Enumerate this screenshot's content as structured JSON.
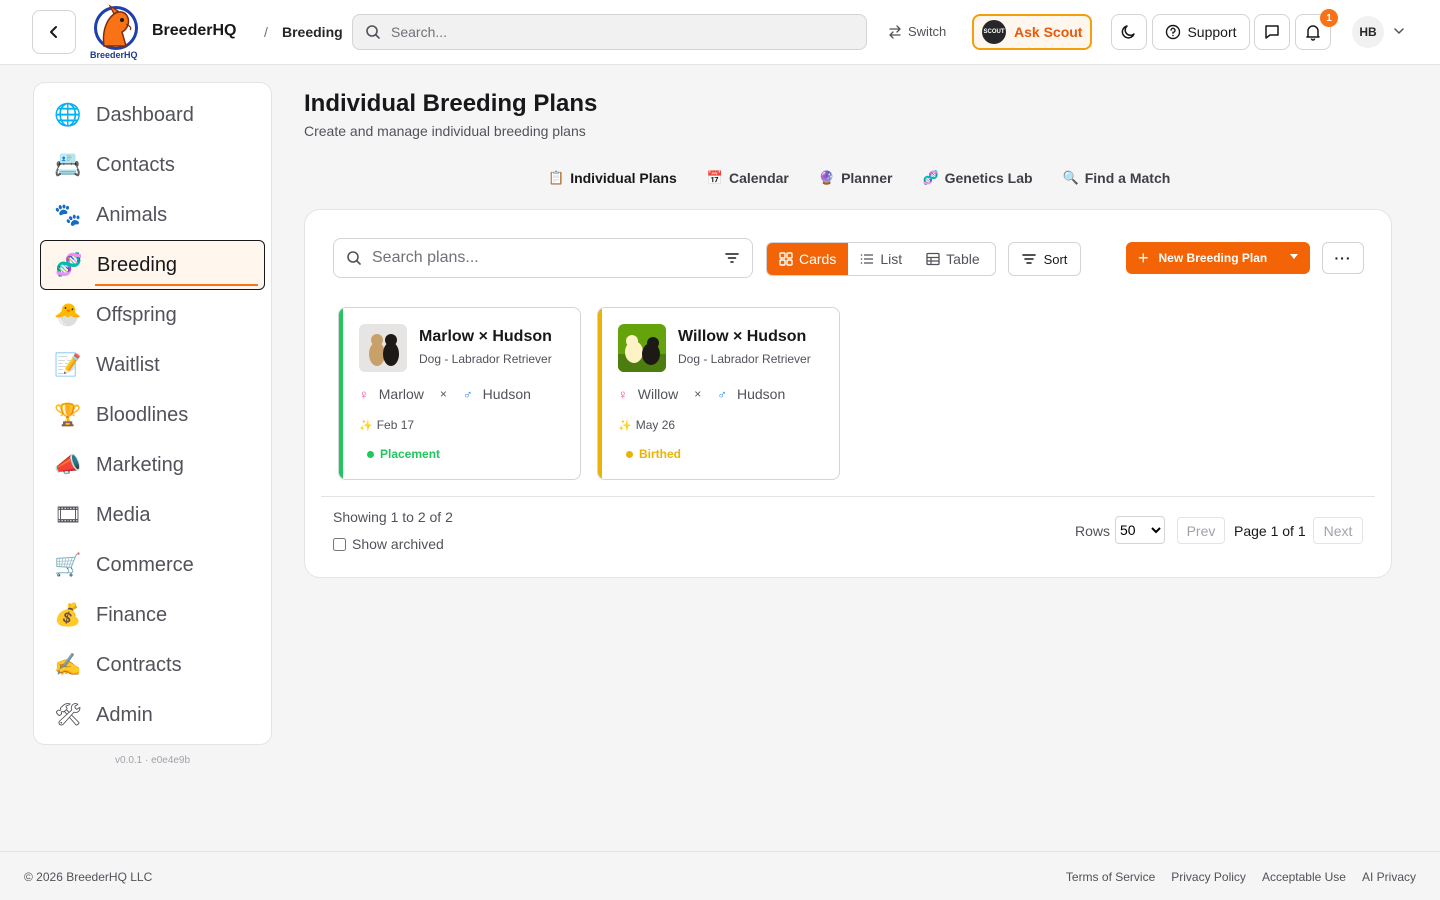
{
  "header": {
    "brand": "BreederHQ",
    "logo_label": "BreederHQ",
    "breadcrumb_sep": "/",
    "breadcrumb": "Breeding",
    "search_placeholder": "Search...",
    "switch_label": "Switch",
    "ask_scout_label": "Ask Scout",
    "scout_badge": "SCOUT",
    "support_label": "Support",
    "notification_count": "1",
    "avatar_initials": "HB"
  },
  "sidebar": {
    "items": [
      {
        "label": "Dashboard",
        "icon": "🌐"
      },
      {
        "label": "Contacts",
        "icon": "📇"
      },
      {
        "label": "Animals",
        "icon": "🐾"
      },
      {
        "label": "Breeding",
        "icon": "🧬"
      },
      {
        "label": "Offspring",
        "icon": "🐣"
      },
      {
        "label": "Waitlist",
        "icon": "📝"
      },
      {
        "label": "Bloodlines",
        "icon": "🏆"
      },
      {
        "label": "Marketing",
        "icon": "📣"
      },
      {
        "label": "Media",
        "icon": "🎞"
      },
      {
        "label": "Commerce",
        "icon": "🛒"
      },
      {
        "label": "Finance",
        "icon": "💰"
      },
      {
        "label": "Contracts",
        "icon": "✍"
      },
      {
        "label": "Admin",
        "icon": "🛠"
      }
    ],
    "active": "Breeding",
    "version": "v0.0.1 · e0e4e9b"
  },
  "page": {
    "title": "Individual Breeding Plans",
    "subtitle": "Create and manage individual breeding plans"
  },
  "subnav": [
    {
      "label": "Individual Plans",
      "icon": "📋"
    },
    {
      "label": "Calendar",
      "icon": "📅"
    },
    {
      "label": "Planner",
      "icon": "🔮"
    },
    {
      "label": "Genetics Lab",
      "icon": "🧬"
    },
    {
      "label": "Find a Match",
      "icon": "🔍"
    }
  ],
  "toolbar": {
    "search_placeholder": "Search plans...",
    "views": [
      "Cards",
      "List",
      "Table"
    ],
    "active_view": "Cards",
    "sort_label": "Sort",
    "new_plan_label": "New Breeding Plan",
    "more_label": "···"
  },
  "plans": [
    {
      "title": "Marlow × Hudson",
      "species": "Dog - Labrador Retriever",
      "dam": "Marlow",
      "sire": "Hudson",
      "times": "×",
      "date": "Feb 17",
      "status": "Placement",
      "color": "#22c55e"
    },
    {
      "title": "Willow × Hudson",
      "species": "Dog - Labrador Retriever",
      "dam": "Willow",
      "sire": "Hudson",
      "times": "×",
      "date": "May 26",
      "status": "Birthed",
      "color": "#eab308"
    }
  ],
  "pagination": {
    "showing": "Showing 1 to 2 of 2",
    "archived_label": "Show archived",
    "rows_label": "Rows",
    "rows_value": "50",
    "prev": "Prev",
    "page_info": "Page 1 of 1",
    "next": "Next"
  },
  "footer": {
    "copyright": "© 2026 BreederHQ LLC",
    "links": [
      "Terms of Service",
      "Privacy Policy",
      "Acceptable Use",
      "AI Privacy"
    ]
  },
  "colors": {
    "accent": "#f26405",
    "scout_border": "#f59e0b"
  }
}
